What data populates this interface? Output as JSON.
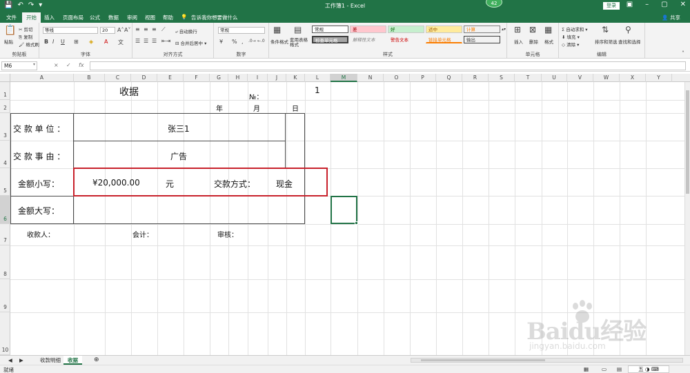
{
  "window": {
    "title": "工作簿1 - Excel",
    "login_label": "登录",
    "notification_count": "42",
    "share_label": "共享"
  },
  "ribbon_tabs": [
    "文件",
    "开始",
    "插入",
    "页面布局",
    "公式",
    "数据",
    "审阅",
    "视图",
    "帮助"
  ],
  "tell_me": "告诉我你想要做什么",
  "ribbon": {
    "clipboard": {
      "paste": "粘贴",
      "cut": "剪切",
      "copy": "复制",
      "format_painter": "格式刷",
      "label": "剪贴板"
    },
    "font": {
      "name": "等线",
      "size": "20",
      "label": "字体"
    },
    "alignment": {
      "wrap": "自动换行",
      "merge": "合并后居中",
      "label": "对齐方式"
    },
    "number": {
      "format": "常规",
      "label": "数字"
    },
    "styles": {
      "cond_format": "条件格式",
      "table_format": "套用表格格式",
      "cells": [
        "常规",
        "差",
        "好",
        "适中",
        "计算",
        "检查单元格",
        "解释性文本",
        "警告文本",
        "链接单元格",
        "输出"
      ],
      "label": "样式"
    },
    "cells": {
      "insert": "插入",
      "delete": "删除",
      "format": "格式",
      "label": "单元格"
    },
    "editing": {
      "autosum": "自动求和",
      "fill": "填充",
      "clear": "清除",
      "sort": "排序和筛选",
      "find": "查找和选择",
      "label": "编辑"
    }
  },
  "formula_bar": {
    "name_box": "M6",
    "cancel": "×",
    "enter": "✓",
    "fx": "fx",
    "value": ""
  },
  "columns": [
    "A",
    "B",
    "C",
    "D",
    "E",
    "F",
    "G",
    "H",
    "I",
    "J",
    "K",
    "L",
    "M",
    "N",
    "O",
    "P",
    "Q",
    "R",
    "S",
    "T",
    "U",
    "V",
    "W",
    "X",
    "Y"
  ],
  "rows": [
    "1",
    "2",
    "3",
    "4",
    "5",
    "6",
    "7",
    "8",
    "9",
    "10"
  ],
  "receipt": {
    "title": "收据",
    "no_label": "№：",
    "no_value": "1",
    "year": "年",
    "month": "月",
    "day": "日",
    "payer_label": "交 款 单 位 ：",
    "payer_value": "张三1",
    "reason_label": "交 款 事 由 ：",
    "reason_value": "广告",
    "amount_small_label": "金额小写：",
    "amount_small_value": "¥20,000.00",
    "yuan": "元",
    "method_label": "交款方式：",
    "method_value": "现金",
    "amount_large_label": "金额大写：",
    "payee": "收款人：",
    "accountant": "会计：",
    "reviewer": "审核："
  },
  "sheets": [
    "收款明细",
    "收据"
  ],
  "active_sheet": "收据",
  "status": {
    "ready": "就绪",
    "ime": "五"
  },
  "watermark": {
    "brand": "Baidu经验",
    "url": "jingyan.baidu.com"
  },
  "colors": {
    "excel_green": "#217346",
    "highlight_red": "#c8202a"
  }
}
